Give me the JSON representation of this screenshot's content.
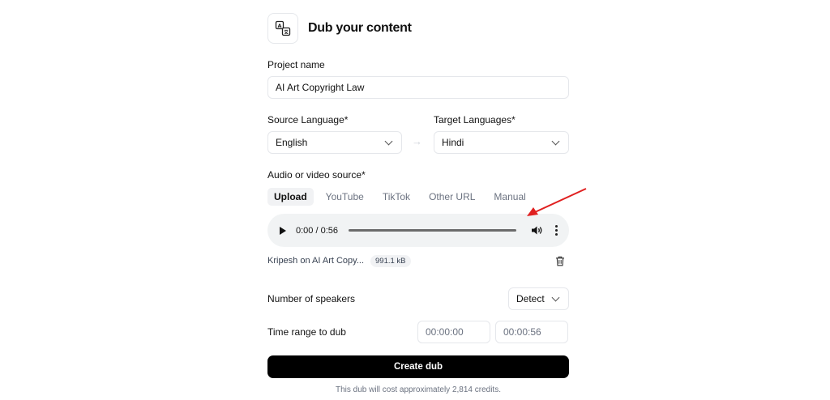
{
  "header": {
    "title": "Dub your content",
    "icon": "translate-icon"
  },
  "project": {
    "label": "Project name",
    "value": "AI Art Copyright Law"
  },
  "languages": {
    "source_label": "Source Language*",
    "source_value": "English",
    "target_label": "Target Languages*",
    "target_value": "Hindi",
    "arrow": "→"
  },
  "source": {
    "label": "Audio or video source*",
    "tabs": [
      "Upload",
      "YouTube",
      "TikTok",
      "Other URL",
      "Manual"
    ],
    "active_tab": "Upload"
  },
  "player": {
    "time": "0:00 / 0:56",
    "progress": 0
  },
  "file": {
    "name": "Kripesh on AI Art Copy...",
    "size": "991.1 kB"
  },
  "speakers": {
    "label": "Number of speakers",
    "value": "Detect"
  },
  "time_range": {
    "label": "Time range to dub",
    "start": "00:00:00",
    "end": "00:00:56"
  },
  "cta": {
    "label": "Create dub"
  },
  "footnote": "This dub will cost approximately 2,814 credits.",
  "colors": {
    "annotation_arrow": "#e02020",
    "cta_bg": "#000000",
    "player_bg": "#f1f3f4"
  }
}
